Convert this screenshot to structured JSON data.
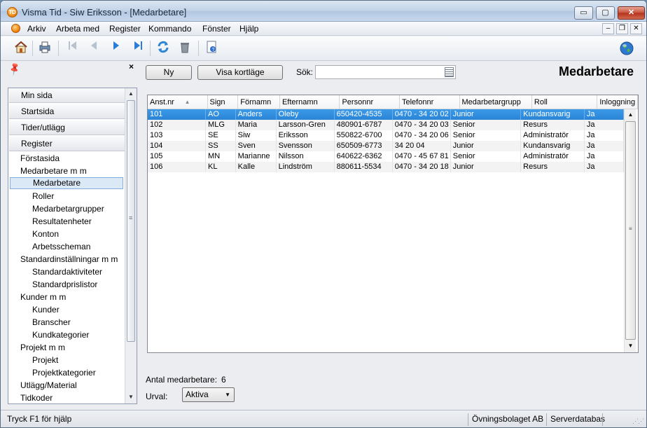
{
  "window": {
    "title": "Visma Tid - Siw Eriksson - [Medarbetare]",
    "app_icon_text": "TD",
    "controls": {
      "minimize": "▭",
      "maximize": "▢",
      "close": "✕"
    }
  },
  "menu": {
    "items": [
      "Arkiv",
      "Arbeta med",
      "Register",
      "Kommando",
      "Fönster",
      "Hjälp"
    ],
    "mdi_controls": {
      "minimize": "–",
      "restore": "❐",
      "close": "✕"
    }
  },
  "toolbar": {
    "icons": [
      "home-icon",
      "print-icon",
      "first-record-icon",
      "previous-record-icon",
      "next-record-icon",
      "last-record-icon",
      "refresh-icon",
      "delete-icon",
      "help-icon",
      "globe-icon"
    ]
  },
  "sidebar": {
    "close_glyph": "×",
    "sections": [
      "Min sida",
      "Startsida",
      "Tider/utlägg",
      "Register"
    ],
    "items": [
      {
        "label": "Förstasida",
        "level": 1
      },
      {
        "label": "Medarbetare m m",
        "level": 1
      },
      {
        "label": "Medarbetare",
        "level": 2,
        "selected": true
      },
      {
        "label": "Roller",
        "level": 2
      },
      {
        "label": "Medarbetargrupper",
        "level": 2
      },
      {
        "label": "Resultatenheter",
        "level": 2
      },
      {
        "label": "Konton",
        "level": 2
      },
      {
        "label": "Arbetsscheman",
        "level": 2
      },
      {
        "label": "Standardinställningar m m",
        "level": 1
      },
      {
        "label": "Standardaktiviteter",
        "level": 2
      },
      {
        "label": "Standardprislistor",
        "level": 2
      },
      {
        "label": "Kunder m m",
        "level": 1
      },
      {
        "label": "Kunder",
        "level": 2
      },
      {
        "label": "Branscher",
        "level": 2
      },
      {
        "label": "Kundkategorier",
        "level": 2
      },
      {
        "label": "Projekt m m",
        "level": 1
      },
      {
        "label": "Projekt",
        "level": 2
      },
      {
        "label": "Projektkategorier",
        "level": 2
      },
      {
        "label": "Utlägg/Material",
        "level": 1
      },
      {
        "label": "Tidkoder",
        "level": 1
      }
    ]
  },
  "main": {
    "new_button": "Ny",
    "card_button": "Visa kortläge",
    "search_label": "Sök:",
    "search_value": "",
    "page_title": "Medarbetare",
    "count_label": "Antal medarbetare:",
    "count_value": "6",
    "filter_label": "Urval:",
    "filter_value": "Aktiva"
  },
  "table": {
    "columns": [
      "Anst.nr",
      "Sign",
      "Förnamn",
      "Efternamn",
      "Personnr",
      "Telefonnr",
      "Medarbetargrupp",
      "Roll",
      "Inloggning"
    ],
    "sort_glyph": "▲",
    "rows": [
      [
        "101",
        "AO",
        "Anders",
        "Oleby",
        "650420-4535",
        "0470 - 34 20 02",
        "Junior",
        "Kundansvarig",
        "Ja"
      ],
      [
        "102",
        "MLG",
        "Maria",
        "Larsson-Gren",
        "480901-6787",
        "0470 - 34 20 03",
        "Senior",
        "Resurs",
        "Ja"
      ],
      [
        "103",
        "SE",
        "Siw",
        "Eriksson",
        "550822-6700",
        "0470 - 34 20 06",
        "Senior",
        "Administratör",
        "Ja"
      ],
      [
        "104",
        "SS",
        "Sven",
        "Svensson",
        "650509-6773",
        "34 20 04",
        "Junior",
        "Kundansvarig",
        "Ja"
      ],
      [
        "105",
        "MN",
        "Marianne",
        "Nilsson",
        "640622-6362",
        "0470 - 45 67 81",
        "Senior",
        "Administratör",
        "Ja"
      ],
      [
        "106",
        "KL",
        "Kalle",
        "Lindström",
        "880611-5534",
        "0470 - 34 20 18",
        "Junior",
        "Resurs",
        "Ja"
      ]
    ],
    "selected_row": 0
  },
  "statusbar": {
    "help": "Tryck F1 för hjälp",
    "company": "Övningsbolaget AB",
    "database": "Serverdatabas"
  },
  "colors": {
    "selection": "#3b9ae8",
    "nav_selected": "#dbe9f7",
    "window_bg": "#ecedf1"
  }
}
